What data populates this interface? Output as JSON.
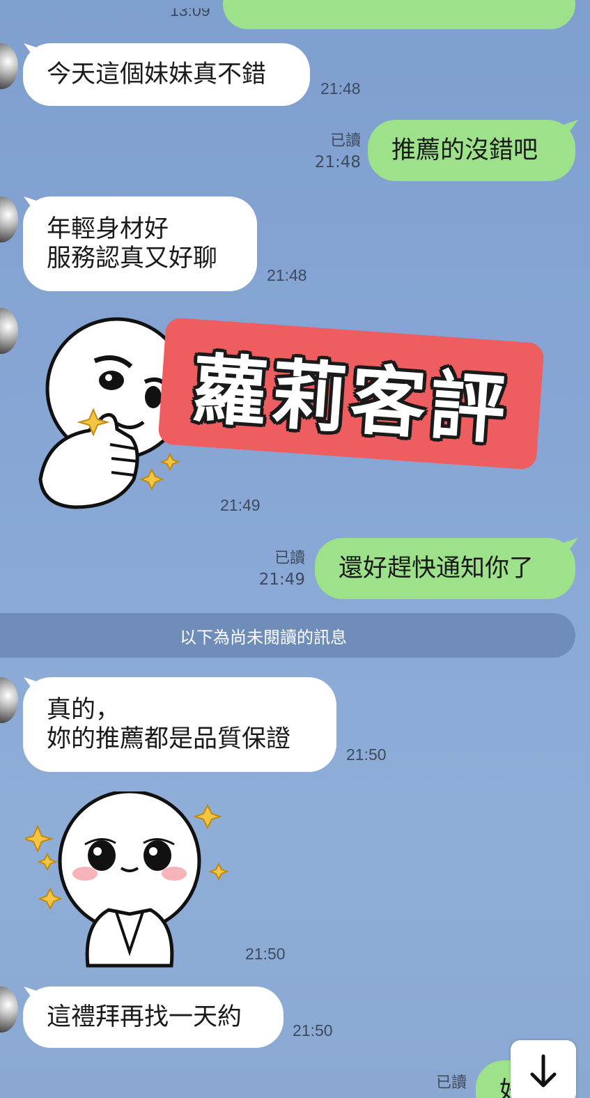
{
  "top_partial": {
    "time": "13:09"
  },
  "messages": [
    {
      "id": "m1",
      "text": "今天這個妹妹真不錯",
      "time": "21:48"
    },
    {
      "id": "m2",
      "text": "推薦的沒錯吧",
      "time": "21:48",
      "read": "已讀"
    },
    {
      "id": "m3",
      "text": "年輕身材好\n服務認真又好聊",
      "time": "21:48"
    },
    {
      "id": "m4",
      "sticker": "thumbs-up-smirk-face",
      "time": "21:49"
    },
    {
      "id": "m5",
      "text": "還好趕快通知你了",
      "time": "21:49",
      "read": "已讀"
    },
    {
      "id": "m6",
      "text": "真的，\n妳的推薦都是品質保證",
      "time": "21:50"
    },
    {
      "id": "m7",
      "sticker": "blushing-pleading-face",
      "time": "21:50"
    },
    {
      "id": "m8",
      "text": "這禮拜再找一天約",
      "time": "21:50"
    },
    {
      "id": "m9",
      "text": "好",
      "read": "已讀"
    }
  ],
  "unread_divider": "以下為尚未閱讀的訊息",
  "overlay_stamp": "蘿莉客評",
  "scroll_button_icon": "arrow-down-icon",
  "colors": {
    "incoming": "#ffffff",
    "outgoing": "#9de28b",
    "background": "#86a5d3",
    "stamp": "#ee5d5f"
  }
}
